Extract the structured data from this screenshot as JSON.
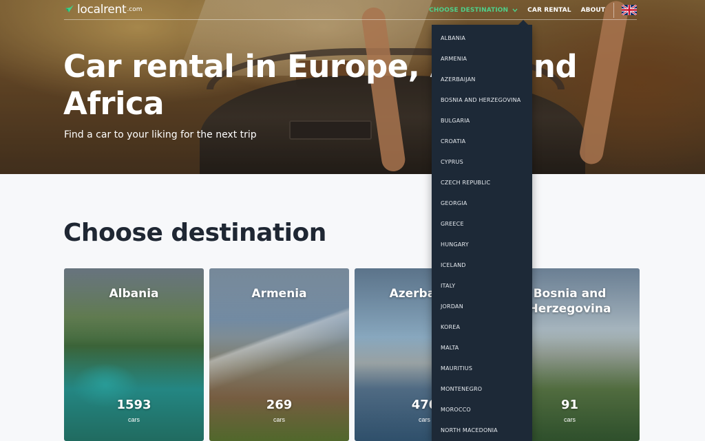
{
  "nav": {
    "logo_text": "localrent",
    "logo_suffix": ".com",
    "links": {
      "choose_destination": "CHOOSE DESTINATION",
      "car_rental": "CAR RENTAL",
      "about": "ABOUT"
    },
    "language_icon": "uk-flag-icon",
    "accent_color": "#4fcf8a"
  },
  "hero": {
    "title": "Car rental in Europe, Asia and Africa",
    "subtitle": "Find a car to your liking for the next trip"
  },
  "destinations": {
    "title": "Choose destination",
    "cards": [
      {
        "name": "Albania",
        "count": "1593",
        "unit": "cars"
      },
      {
        "name": "Armenia",
        "count": "269",
        "unit": "cars"
      },
      {
        "name": "Azerbaijan",
        "count": "470",
        "unit": "cars"
      },
      {
        "name": "Bosnia and Herzegovina",
        "count": "91",
        "unit": "cars"
      }
    ]
  },
  "dropdown": {
    "items": [
      "ALBANIA",
      "ARMENIA",
      "AZERBAIJAN",
      "BOSNIA AND HERZEGOVINA",
      "BULGARIA",
      "CROATIA",
      "CYPRUS",
      "CZECH REPUBLIC",
      "GEORGIA",
      "GREECE",
      "HUNGARY",
      "ICELAND",
      "ITALY",
      "JORDAN",
      "KOREA",
      "MALTA",
      "MAURITIUS",
      "MONTENEGRO",
      "MOROCCO",
      "NORTH MACEDONIA"
    ],
    "background_color": "#1d2937"
  }
}
